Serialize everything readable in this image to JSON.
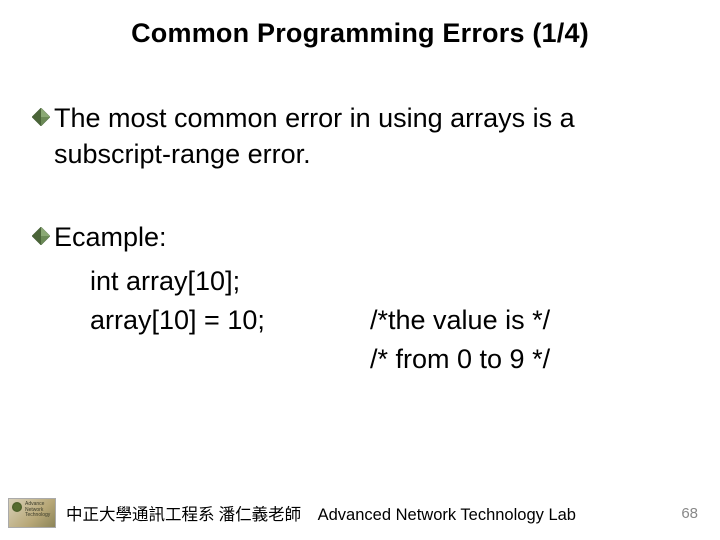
{
  "title": "Common Programming Errors (1/4)",
  "bullets": [
    {
      "text": "The most common error in using arrays is a subscript-range error."
    },
    {
      "text": "Ecample:",
      "code": {
        "line1": "int array[10];",
        "line2_left": "array[10] = 10;",
        "line2_right": "/*the value is */",
        "line3": "/* from 0 to 9 */"
      }
    }
  ],
  "footer": {
    "logo_lines": [
      "Advance",
      "Network",
      "Technology"
    ],
    "org": "中正大學通訊工程系 潘仁義老師",
    "lab": "Advanced Network Technology Lab",
    "page": "68"
  }
}
